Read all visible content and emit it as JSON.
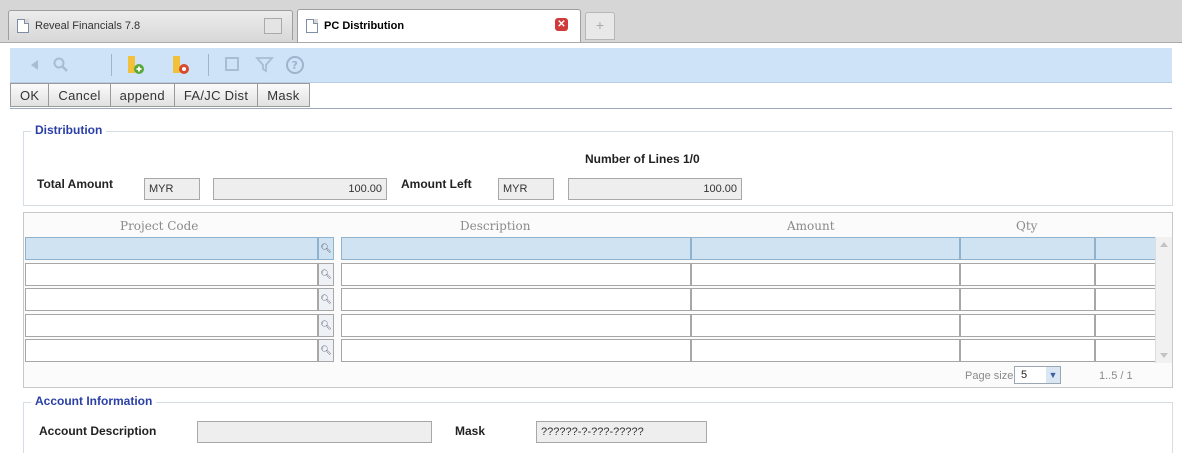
{
  "tabs": [
    {
      "label": "Reveal Financials 7.8",
      "active": false
    },
    {
      "label": "PC Distribution",
      "active": true
    }
  ],
  "new_tab_symbol": "+",
  "toolbar": {
    "icons": [
      "first-icon",
      "search-icon",
      "add-line-icon",
      "delete-line-icon",
      "copy-icon",
      "filter-icon",
      "help-icon"
    ]
  },
  "buttons": [
    "OK",
    "Cancel",
    "append",
    "FA/JC Dist",
    "Mask"
  ],
  "distribution": {
    "legend": "Distribution",
    "number_of_lines": "Number of Lines 1/0",
    "total_amount_label": "Total Amount",
    "total_currency": "MYR",
    "total_amount": "100.00",
    "amount_left_label": "Amount Left",
    "left_currency": "MYR",
    "amount_left": "100.00"
  },
  "grid": {
    "columns": [
      "Project Code",
      "Description",
      "Amount",
      "Qty"
    ],
    "rows": 5,
    "page_size_label": "Page size:",
    "page_size": "5",
    "page_info": "1..5 / 1"
  },
  "account": {
    "legend": "Account Information",
    "description_label": "Account Description",
    "description_value": "",
    "mask_label": "Mask",
    "mask_value": "??????-?-???-?????"
  },
  "colors": {
    "legend": "#2a3fa5",
    "toolbar_bg": "#cfe3f8",
    "row_highlight": "#cfe3f2",
    "add_icon": "#5aa83a",
    "delete_icon": "#d94a2a",
    "close_tab": "#d03a3a"
  }
}
